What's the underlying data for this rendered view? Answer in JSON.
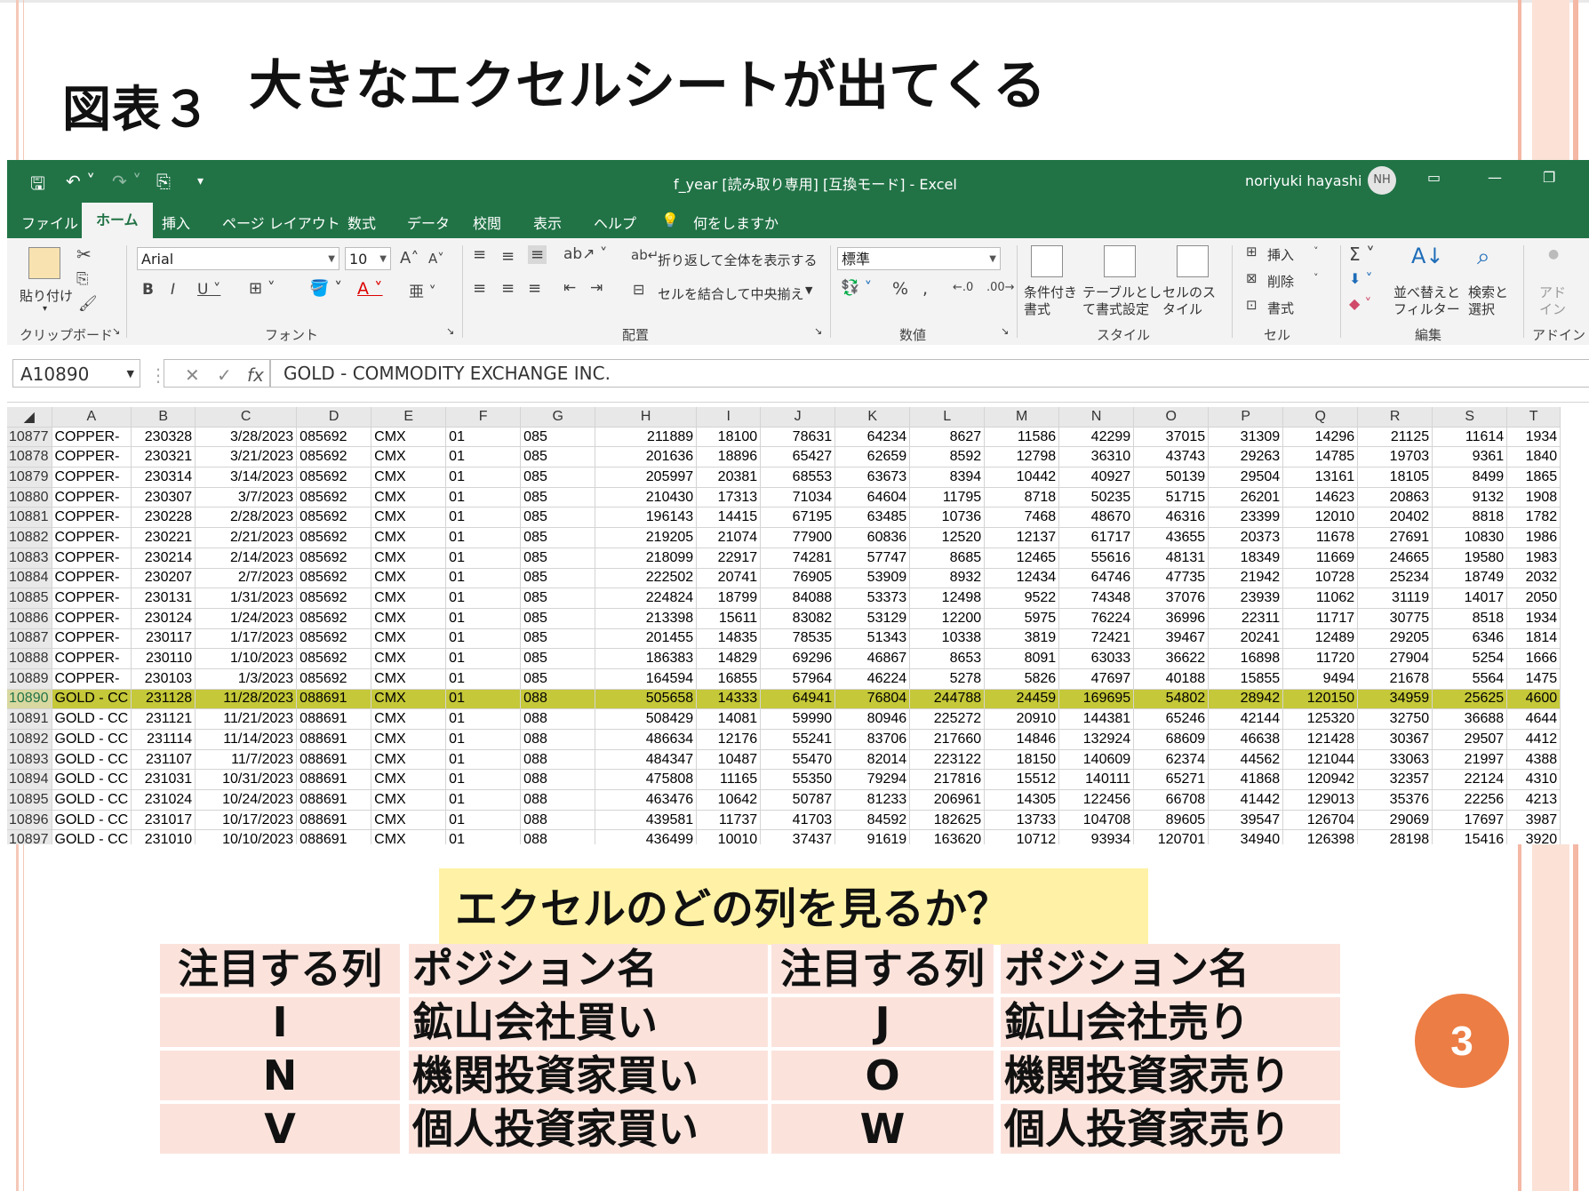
{
  "slide": {
    "figure_label": "図表３",
    "title": "大きなエクセルシートが出てくる",
    "page_number": "3"
  },
  "excel": {
    "window_title": "f_year [読み取り専用] [互換モード] - Excel",
    "user_name": "noriyuki hayashi",
    "user_initials": "NH",
    "tabs": [
      "ファイル",
      "ホーム",
      "挿入",
      "ページ レイアウト",
      "数式",
      "データ",
      "校閲",
      "表示",
      "ヘルプ",
      "何をしますか"
    ],
    "ribbon": {
      "paste_label": "貼り付け",
      "clipboard_group": "クリップボード",
      "font_name": "Arial",
      "font_size": "10",
      "font_group": "フォント",
      "wrap_text": "折り返して全体を表示する",
      "merge_center": "セルを結合して中央揃え",
      "alignment_group": "配置",
      "number_format": "標準",
      "number_group": "数値",
      "cond_format": "条件付き書式",
      "format_table": "テーブルとして書式設定",
      "cell_styles": "セルのスタイル",
      "styles_group": "スタイル",
      "insert": "挿入",
      "delete": "削除",
      "format": "書式",
      "cells_group": "セル",
      "sort_filter": "並べ替えとフィルター",
      "find_select": "検索と選択",
      "editing_group": "編集",
      "addin": "アドイン",
      "addin_group": "アドイン"
    },
    "name_box": "A10890",
    "formula": "GOLD - COMMODITY EXCHANGE INC.",
    "columns": [
      "A",
      "B",
      "C",
      "D",
      "E",
      "F",
      "G",
      "H",
      "I",
      "J",
      "K",
      "L",
      "M",
      "N",
      "O",
      "P",
      "Q",
      "R",
      "S",
      "T"
    ],
    "selected_row": "10890",
    "rows": [
      [
        "10877",
        "COPPER-",
        "230328",
        "3/28/2023",
        "085692",
        "CMX",
        "01",
        "085",
        "211889",
        "18100",
        "78631",
        "64234",
        "8627",
        "11586",
        "42299",
        "37015",
        "31309",
        "14296",
        "21125",
        "11614",
        "1934"
      ],
      [
        "10878",
        "COPPER-",
        "230321",
        "3/21/2023",
        "085692",
        "CMX",
        "01",
        "085",
        "201636",
        "18896",
        "65427",
        "62659",
        "8592",
        "12798",
        "36310",
        "43743",
        "29263",
        "14785",
        "19703",
        "9361",
        "1840"
      ],
      [
        "10879",
        "COPPER-",
        "230314",
        "3/14/2023",
        "085692",
        "CMX",
        "01",
        "085",
        "205997",
        "20381",
        "68553",
        "63673",
        "8394",
        "10442",
        "40927",
        "50139",
        "29504",
        "13161",
        "18105",
        "8499",
        "1865"
      ],
      [
        "10880",
        "COPPER-",
        "230307",
        "3/7/2023",
        "085692",
        "CMX",
        "01",
        "085",
        "210430",
        "17313",
        "71034",
        "64604",
        "11795",
        "8718",
        "50235",
        "51715",
        "26201",
        "14623",
        "20863",
        "9132",
        "1908"
      ],
      [
        "10881",
        "COPPER-",
        "230228",
        "2/28/2023",
        "085692",
        "CMX",
        "01",
        "085",
        "196143",
        "14415",
        "67195",
        "63485",
        "10736",
        "7468",
        "48670",
        "46316",
        "23399",
        "12010",
        "20402",
        "8818",
        "1782"
      ],
      [
        "10882",
        "COPPER-",
        "230221",
        "2/21/2023",
        "085692",
        "CMX",
        "01",
        "085",
        "219205",
        "21074",
        "77900",
        "60836",
        "12520",
        "12137",
        "61717",
        "43655",
        "20373",
        "11678",
        "27691",
        "10830",
        "1986"
      ],
      [
        "10883",
        "COPPER-",
        "230214",
        "2/14/2023",
        "085692",
        "CMX",
        "01",
        "085",
        "218099",
        "22917",
        "74281",
        "57747",
        "8685",
        "12465",
        "55616",
        "48131",
        "18349",
        "11669",
        "24665",
        "19580",
        "1983"
      ],
      [
        "10884",
        "COPPER-",
        "230207",
        "2/7/2023",
        "085692",
        "CMX",
        "01",
        "085",
        "222502",
        "20741",
        "76905",
        "53909",
        "8932",
        "12434",
        "64746",
        "47735",
        "21942",
        "10728",
        "25234",
        "18749",
        "2032"
      ],
      [
        "10885",
        "COPPER-",
        "230131",
        "1/31/2023",
        "085692",
        "CMX",
        "01",
        "085",
        "224824",
        "18799",
        "84088",
        "53373",
        "12498",
        "9522",
        "74348",
        "37076",
        "23939",
        "11062",
        "31119",
        "14017",
        "2050"
      ],
      [
        "10886",
        "COPPER-",
        "230124",
        "1/24/2023",
        "085692",
        "CMX",
        "01",
        "085",
        "213398",
        "15611",
        "83082",
        "53129",
        "12200",
        "5975",
        "76224",
        "36996",
        "22311",
        "11717",
        "30775",
        "8518",
        "1934"
      ],
      [
        "10887",
        "COPPER-",
        "230117",
        "1/17/2023",
        "085692",
        "CMX",
        "01",
        "085",
        "201455",
        "14835",
        "78535",
        "51343",
        "10338",
        "3819",
        "72421",
        "39467",
        "20241",
        "12489",
        "29205",
        "6346",
        "1814"
      ],
      [
        "10888",
        "COPPER-",
        "230110",
        "1/10/2023",
        "085692",
        "CMX",
        "01",
        "085",
        "186383",
        "14829",
        "69296",
        "46867",
        "8653",
        "8091",
        "63033",
        "36622",
        "16898",
        "11720",
        "27904",
        "5254",
        "1666"
      ],
      [
        "10889",
        "COPPER-",
        "230103",
        "1/3/2023",
        "085692",
        "CMX",
        "01",
        "085",
        "164594",
        "16855",
        "57964",
        "46224",
        "5278",
        "5826",
        "47697",
        "40188",
        "15855",
        "9494",
        "21678",
        "5564",
        "1475"
      ],
      [
        "10890",
        "GOLD - CC",
        "231128",
        "11/28/2023",
        "088691",
        "CMX",
        "01",
        "088",
        "505658",
        "14333",
        "64941",
        "76804",
        "244788",
        "24459",
        "169695",
        "54802",
        "28942",
        "120150",
        "34959",
        "25625",
        "4600"
      ],
      [
        "10891",
        "GOLD - CC",
        "231121",
        "11/21/2023",
        "088691",
        "CMX",
        "01",
        "088",
        "508429",
        "14081",
        "59990",
        "80946",
        "225272",
        "20910",
        "144381",
        "65246",
        "42144",
        "125320",
        "32750",
        "36688",
        "4644"
      ],
      [
        "10892",
        "GOLD - CC",
        "231114",
        "11/14/2023",
        "088691",
        "CMX",
        "01",
        "088",
        "486634",
        "12176",
        "55241",
        "83706",
        "217660",
        "14846",
        "132924",
        "68609",
        "46638",
        "121428",
        "30367",
        "29507",
        "4412"
      ],
      [
        "10893",
        "GOLD - CC",
        "231107",
        "11/7/2023",
        "088691",
        "CMX",
        "01",
        "088",
        "484347",
        "10487",
        "55470",
        "82014",
        "223122",
        "18150",
        "140609",
        "62374",
        "44562",
        "121044",
        "33063",
        "21997",
        "4388"
      ],
      [
        "10894",
        "GOLD - CC",
        "231031",
        "10/31/2023",
        "088691",
        "CMX",
        "01",
        "088",
        "475808",
        "11165",
        "55350",
        "79294",
        "217816",
        "15512",
        "140111",
        "65271",
        "41868",
        "120942",
        "32357",
        "22124",
        "4310"
      ],
      [
        "10895",
        "GOLD - CC",
        "231024",
        "10/24/2023",
        "088691",
        "CMX",
        "01",
        "088",
        "463476",
        "10642",
        "50787",
        "81233",
        "206961",
        "14305",
        "122456",
        "66708",
        "41442",
        "129013",
        "35376",
        "22256",
        "4213"
      ],
      [
        "10896",
        "GOLD - CC",
        "231017",
        "10/17/2023",
        "088691",
        "CMX",
        "01",
        "088",
        "439581",
        "11737",
        "41703",
        "84592",
        "182625",
        "13733",
        "104708",
        "89605",
        "39547",
        "126704",
        "29069",
        "17697",
        "3987"
      ],
      [
        "10897",
        "GOLD - CC",
        "231010",
        "10/10/2023",
        "088691",
        "CMX",
        "01",
        "088",
        "436499",
        "10010",
        "37437",
        "91619",
        "163620",
        "10712",
        "93934",
        "120701",
        "34940",
        "126398",
        "28198",
        "15416",
        "3920"
      ]
    ]
  },
  "question": "エクセルのどの列を見るか？",
  "positions": {
    "headers": [
      "注目する列",
      "ポジション名",
      "注目する列",
      "ポジション名"
    ],
    "rows": [
      [
        "I",
        "鉱山会社買い",
        "J",
        "鉱山会社売り"
      ],
      [
        "N",
        "機関投資家買い",
        "O",
        "機関投資家売り"
      ],
      [
        "V",
        "個人投資家買い",
        "W",
        "個人投資家売り"
      ]
    ]
  },
  "colors": {
    "excel_green": "#217346",
    "selected_row": "#c5c838",
    "question_bg": "#fff2a6",
    "table_pink": "#fbe3dc",
    "page_badge": "#ec7d44"
  }
}
